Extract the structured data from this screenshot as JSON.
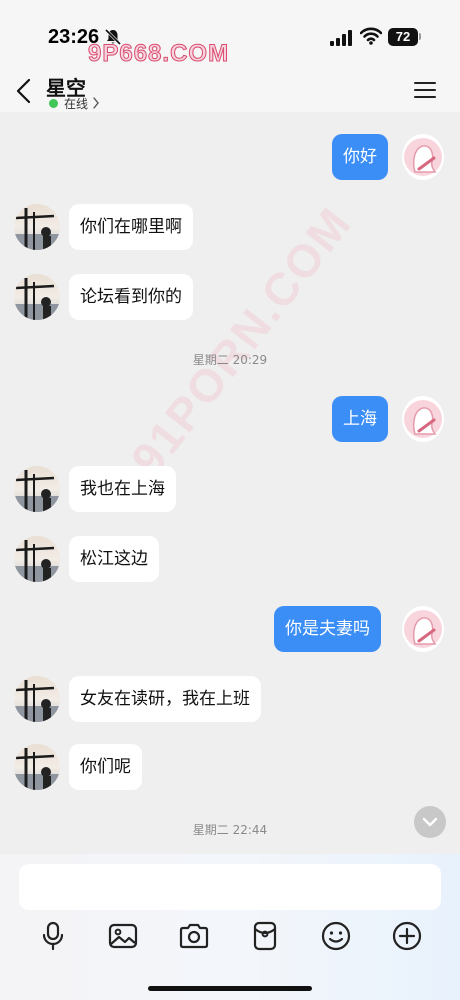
{
  "status_bar": {
    "time": "23:26",
    "battery": "72",
    "watermark": "9P668.COM"
  },
  "header": {
    "contact_name": "星空",
    "presence": "在线"
  },
  "messages": [
    {
      "side": "out",
      "text": "你好"
    },
    {
      "side": "in",
      "text": "你们在哪里啊"
    },
    {
      "side": "in",
      "text": "论坛看到你的"
    },
    {
      "type": "time",
      "text": "星期二 20:29"
    },
    {
      "side": "out",
      "text": "上海"
    },
    {
      "side": "in",
      "text": "我也在上海"
    },
    {
      "side": "in",
      "text": "松江这边"
    },
    {
      "side": "out",
      "text": "你是夫妻吗"
    },
    {
      "side": "in",
      "text": "女友在读研，我在上班"
    },
    {
      "side": "in",
      "text": "你们呢"
    },
    {
      "type": "time",
      "text": "星期二 22:44"
    }
  ],
  "watermark_diagonal": "91PORN.COM",
  "input": {
    "placeholder": ""
  },
  "toolbar": {
    "icons": [
      "microphone-icon",
      "image-icon",
      "camera-icon",
      "red-packet-icon",
      "emoji-icon",
      "plus-icon"
    ]
  },
  "colors": {
    "outgoing_bubble": "#3b8ef6",
    "incoming_bubble": "#ffffff",
    "background": "#efefef",
    "online": "#41c65a"
  }
}
